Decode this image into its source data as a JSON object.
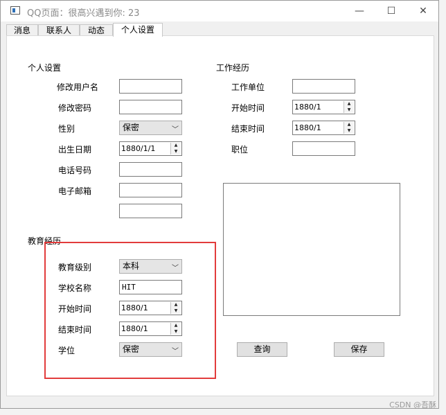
{
  "window": {
    "title": "QQ页面：很高兴遇到你: 23",
    "controls": {
      "minimize": "—",
      "maximize": "☐",
      "close": "✕"
    }
  },
  "tabs": [
    "消息",
    "联系人",
    "动态",
    "个人设置"
  ],
  "active_tab": "个人设置",
  "personal": {
    "section_title": "个人设置",
    "labels": {
      "username": "修改用户名",
      "password": "修改密码",
      "gender": "性别",
      "birthdate": "出生日期",
      "phone": "电话号码",
      "email": "电子邮箱"
    },
    "gender_value": "保密",
    "birthdate_value": "1880/1/1"
  },
  "work": {
    "section_title": "工作经历",
    "labels": {
      "company": "工作单位",
      "start": "开始时间",
      "end": "结束时间",
      "position": "职位"
    },
    "start_value": "1880/1",
    "end_value": "1880/1"
  },
  "education": {
    "section_title": "教育经历",
    "labels": {
      "level": "教育级别",
      "school": "学校名称",
      "start": "开始时间",
      "end": "结束时间",
      "degree": "学位"
    },
    "level_value": "本科",
    "school_value": "HIT",
    "start_value": "1880/1",
    "end_value": "1880/1",
    "degree_value": "保密"
  },
  "buttons": {
    "query": "查询",
    "save": "保存"
  },
  "watermark": "CSDN @吾酥",
  "colors": {
    "highlight": "#e23b3b",
    "title_text": "#8a8a8a"
  }
}
